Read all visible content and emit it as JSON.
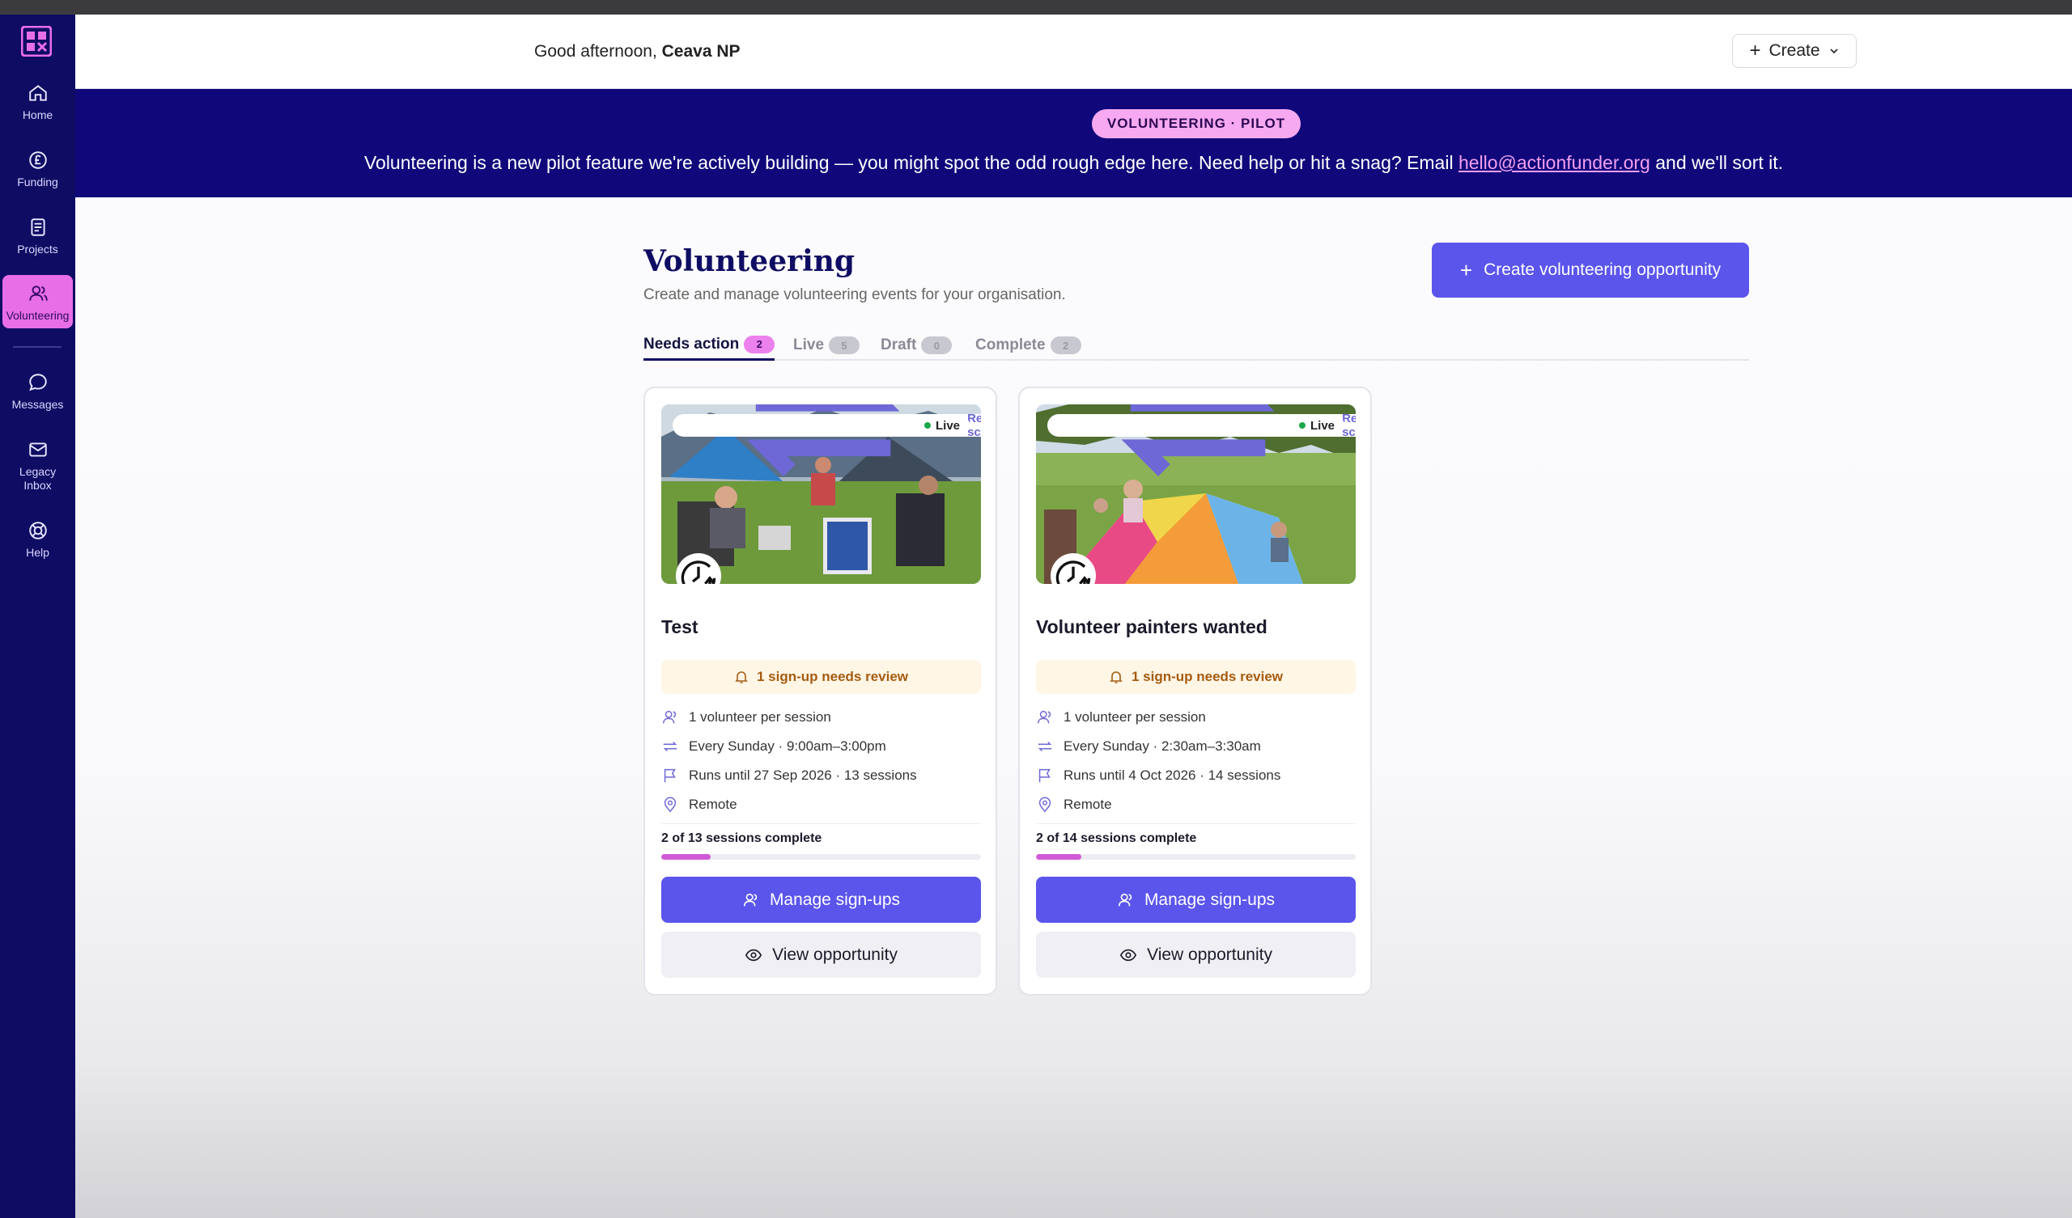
{
  "header": {
    "greeting_prefix": "Good afternoon,",
    "user_name": "Ceava NP",
    "create_label": "Create"
  },
  "sidebar": {
    "items": [
      {
        "label": "Home",
        "icon": "home-icon"
      },
      {
        "label": "Funding",
        "icon": "pound-icon"
      },
      {
        "label": "Projects",
        "icon": "document-icon"
      },
      {
        "label": "Volunteering",
        "icon": "people-icon",
        "active": true
      },
      {
        "label": "Messages",
        "icon": "chat-icon"
      },
      {
        "label": "Legacy Inbox",
        "icon": "mail-icon"
      },
      {
        "label": "Help",
        "icon": "lifebuoy-icon"
      }
    ]
  },
  "banner": {
    "pill": "VOLUNTEERING · PILOT",
    "text_before": "Volunteering is a new pilot feature we're actively building — you might spot the odd rough edge here. Need help or hit a snag? Email ",
    "email": "hello@actionfunder.org",
    "text_after": " and we'll sort it."
  },
  "page": {
    "title": "Volunteering",
    "subtitle": "Create and manage volunteering events for your organisation.",
    "create_opportunity_label": "Create volunteering opportunity"
  },
  "tabs": [
    {
      "label": "Needs action",
      "count": "2",
      "active": true
    },
    {
      "label": "Live",
      "count": "5"
    },
    {
      "label": "Draft",
      "count": "0"
    },
    {
      "label": "Complete",
      "count": "2"
    }
  ],
  "cards": [
    {
      "schedule_badge": "Repeating schedule",
      "status_badge": "Live",
      "title": "Test",
      "review": "1 sign-up needs review",
      "volunteers": "1 volunteer per session",
      "schedule": "Every Sunday · 9:00am–3:00pm",
      "runs": "Runs until 27 Sep 2026 · 13 sessions",
      "location": "Remote",
      "progress_label": "2 of 13 sessions complete",
      "progress_fraction": 0.154,
      "manage_label": "Manage sign-ups",
      "view_label": "View opportunity"
    },
    {
      "schedule_badge": "Repeating schedule",
      "status_badge": "Live",
      "title": "Volunteer painters wanted",
      "review": "1 sign-up needs review",
      "volunteers": "1 volunteer per session",
      "schedule": "Every Sunday · 2:30am–3:30am",
      "runs": "Runs until 4 Oct 2026 · 14 sessions",
      "location": "Remote",
      "progress_label": "2 of 14 sessions complete",
      "progress_fraction": 0.143,
      "manage_label": "Manage sign-ups",
      "view_label": "View opportunity"
    }
  ],
  "colors": {
    "sidebar": "#0f0c63",
    "banner": "#10087a",
    "accent": "#5b55ec",
    "active_nav": "#e86ee8",
    "progress": "#d15ad8"
  }
}
